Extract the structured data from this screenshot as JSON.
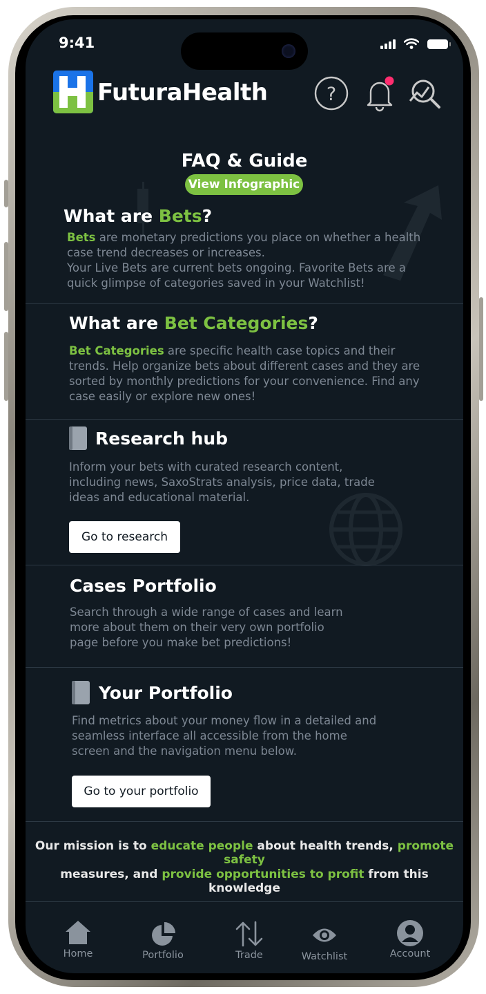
{
  "status_bar": {
    "time": "9:41"
  },
  "header": {
    "brand": "FuturaHealth",
    "icons": [
      "help-icon",
      "bell-icon",
      "search-analytics-icon"
    ],
    "notification_dot_color": "#ff2d6f"
  },
  "faq": {
    "title": "FAQ & Guide",
    "infographic_button": "View Infographic"
  },
  "bets": {
    "title_pre": "What are ",
    "title_accent": "Bets",
    "title_post": "?",
    "para_accent": "Bets",
    "para_line1_rest": " are monetary predictions you place on whether a health",
    "para_line2": "case trend decreases or increases.",
    "para_line3": "Your Live Bets are current bets ongoing. Favorite Bets are a",
    "para_line4": "quick glimpse of categories saved in your Watchlist!"
  },
  "categories": {
    "title_pre": "What are ",
    "title_accent": "Bet Categories",
    "title_post": "?",
    "para_accent": "Bet Categories",
    "para_line1_rest": " are specific health case topics and their",
    "para_line2": "trends. Help organize bets about different cases and they are",
    "para_line3": "sorted by monthly predictions for your convenience. Find any",
    "para_line4": "case easily or explore new ones!"
  },
  "research": {
    "title": "Research hub",
    "line1": "Inform your bets with curated research content,",
    "line2": "including news, SaxoStrats analysis, price data, trade",
    "line3": "ideas and educational material.",
    "button": "Go to research"
  },
  "cases": {
    "title": "Cases Portfolio",
    "line1": "Search through a wide range of cases and learn",
    "line2": "more about them on their very own portfolio",
    "line3": "page before you make bet predictions!"
  },
  "portfolio": {
    "title": "Your Portfolio",
    "line1": "Find metrics about your money flow in a detailed and",
    "line2": "seamless interface all accessible from the home",
    "line3": "screen and the navigation menu below.",
    "button": "Go to your portfolio"
  },
  "mission": {
    "p1": "Our mission is to ",
    "a1": "educate people",
    "p2": " about health trends, ",
    "a2": "promote safety",
    "p3": "measures, and ",
    "a3": "provide opportunities to profit",
    "p4": " from this knowledge"
  },
  "nav": {
    "items": [
      {
        "label": "Home",
        "icon": "home-icon"
      },
      {
        "label": "Portfolio",
        "icon": "pie-chart-icon"
      },
      {
        "label": "Trade",
        "icon": "trade-arrows-icon"
      },
      {
        "label": "Watchlist",
        "icon": "eye-icon"
      },
      {
        "label": "Account",
        "icon": "account-icon"
      }
    ]
  },
  "colors": {
    "background": "#111a22",
    "accent": "#7dc142",
    "logo_blue": "#1a73e8",
    "muted_text": "#7d8793"
  }
}
